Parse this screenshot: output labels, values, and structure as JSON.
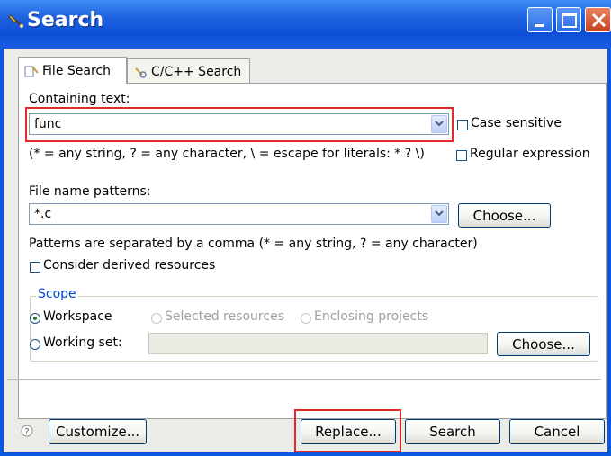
{
  "window": {
    "title": "Search",
    "buttons": [
      "minimize",
      "maximize",
      "close"
    ]
  },
  "tabs": [
    {
      "label": "File Search",
      "icon": "file-search-icon",
      "active": true
    },
    {
      "label": "C/C++ Search",
      "icon": "cpp-search-icon",
      "active": false
    }
  ],
  "containing_text": {
    "label": "Containing text:",
    "value": "func",
    "case_sensitive_label": "Case sensitive",
    "case_sensitive": false,
    "hint": "(* = any string, ? = any character, \\ = escape for literals: * ? \\)",
    "regex_label": "Regular expression",
    "regex": false
  },
  "file_name": {
    "label": "File name patterns:",
    "value": "*.c",
    "choose_label": "Choose...",
    "hint": "Patterns are separated by a comma (* = any string, ? = any character)",
    "derived_label": "Consider derived resources",
    "derived": false
  },
  "scope": {
    "legend": "Scope",
    "workspace_label": "Workspace",
    "selected_resources_label": "Selected resources",
    "enclosing_projects_label": "Enclosing projects",
    "working_set_label": "Working set:",
    "working_set_value": "",
    "choose_label": "Choose...",
    "selected": "Workspace"
  },
  "footer": {
    "help_icon": "help-icon",
    "customize_label": "Customize...",
    "replace_label": "Replace...",
    "search_label": "Search",
    "cancel_label": "Cancel"
  },
  "colors": {
    "titlebar": "#0d4fd6",
    "highlight": "#e32a2a",
    "scope_legend": "#0046d5"
  }
}
